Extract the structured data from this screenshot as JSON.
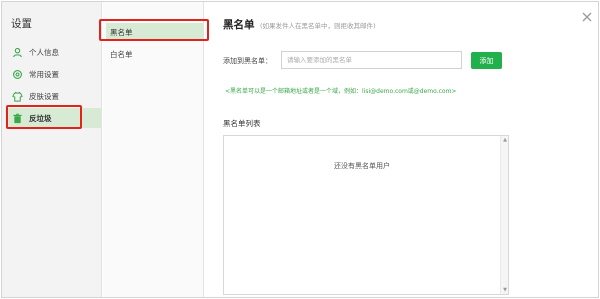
{
  "settings": {
    "title": "设置",
    "nav": [
      {
        "label": "个人信息",
        "icon": "user-icon"
      },
      {
        "label": "常用设置",
        "icon": "settings-icon"
      },
      {
        "label": "皮肤设置",
        "icon": "skin-icon"
      },
      {
        "label": "反垃圾",
        "icon": "trash-icon",
        "active": true
      }
    ]
  },
  "sub_nav": {
    "items": [
      {
        "label": "黑名单",
        "active": true
      },
      {
        "label": "白名单"
      }
    ]
  },
  "main": {
    "title": "黑名单",
    "description": "(如果发件人在黑名单中，则拒收其邮件)",
    "add_label": "添加到黑名单：",
    "input_placeholder": "请输入要添加的黑名单",
    "input_value": "",
    "add_button": "添加",
    "tip": "<黑名单可以是一个邮箱地址或者是一个域，例如：lisi@demo.com或@demo.com>",
    "list_title": "黑名单列表",
    "empty_text": "还没有黑名单用户"
  },
  "colors": {
    "accent_green": "#22b04c",
    "active_bg": "#d6ead4",
    "highlight_red": "#e0231b",
    "tip_green": "#3aa84a"
  }
}
